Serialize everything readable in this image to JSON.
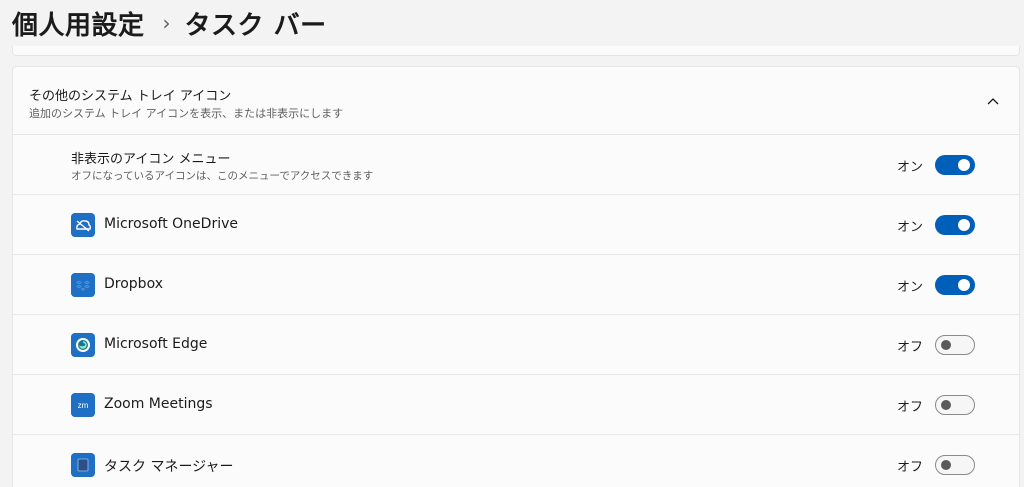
{
  "header": {
    "root": "個人用設定",
    "separator": "›",
    "current": "タスク バー"
  },
  "section": {
    "title": "その他のシステム トレイ アイコン",
    "subtitle": "追加のシステム トレイ アイコンを表示、または非表示にします",
    "expanded": true
  },
  "hidden_menu": {
    "title": "非表示のアイコン メニュー",
    "subtitle": "オフになっているアイコンは、このメニューでアクセスできます",
    "state": "オン",
    "on": true
  },
  "items": [
    {
      "label": "Microsoft OneDrive",
      "icon": "onedrive-icon",
      "state": "オン",
      "on": true
    },
    {
      "label": "Dropbox",
      "icon": "dropbox-icon",
      "state": "オン",
      "on": true
    },
    {
      "label": "Microsoft Edge",
      "icon": "edge-icon",
      "state": "オフ",
      "on": false
    },
    {
      "label": "Zoom Meetings",
      "icon": "zoom-icon",
      "icon_text": "zm",
      "state": "オフ",
      "on": false
    },
    {
      "label": "タスク マネージャー",
      "icon": "task-manager-icon",
      "state": "オフ",
      "on": false
    }
  ],
  "colors": {
    "accent": "#005fb8",
    "icon_bg": "#1f6fc5"
  }
}
